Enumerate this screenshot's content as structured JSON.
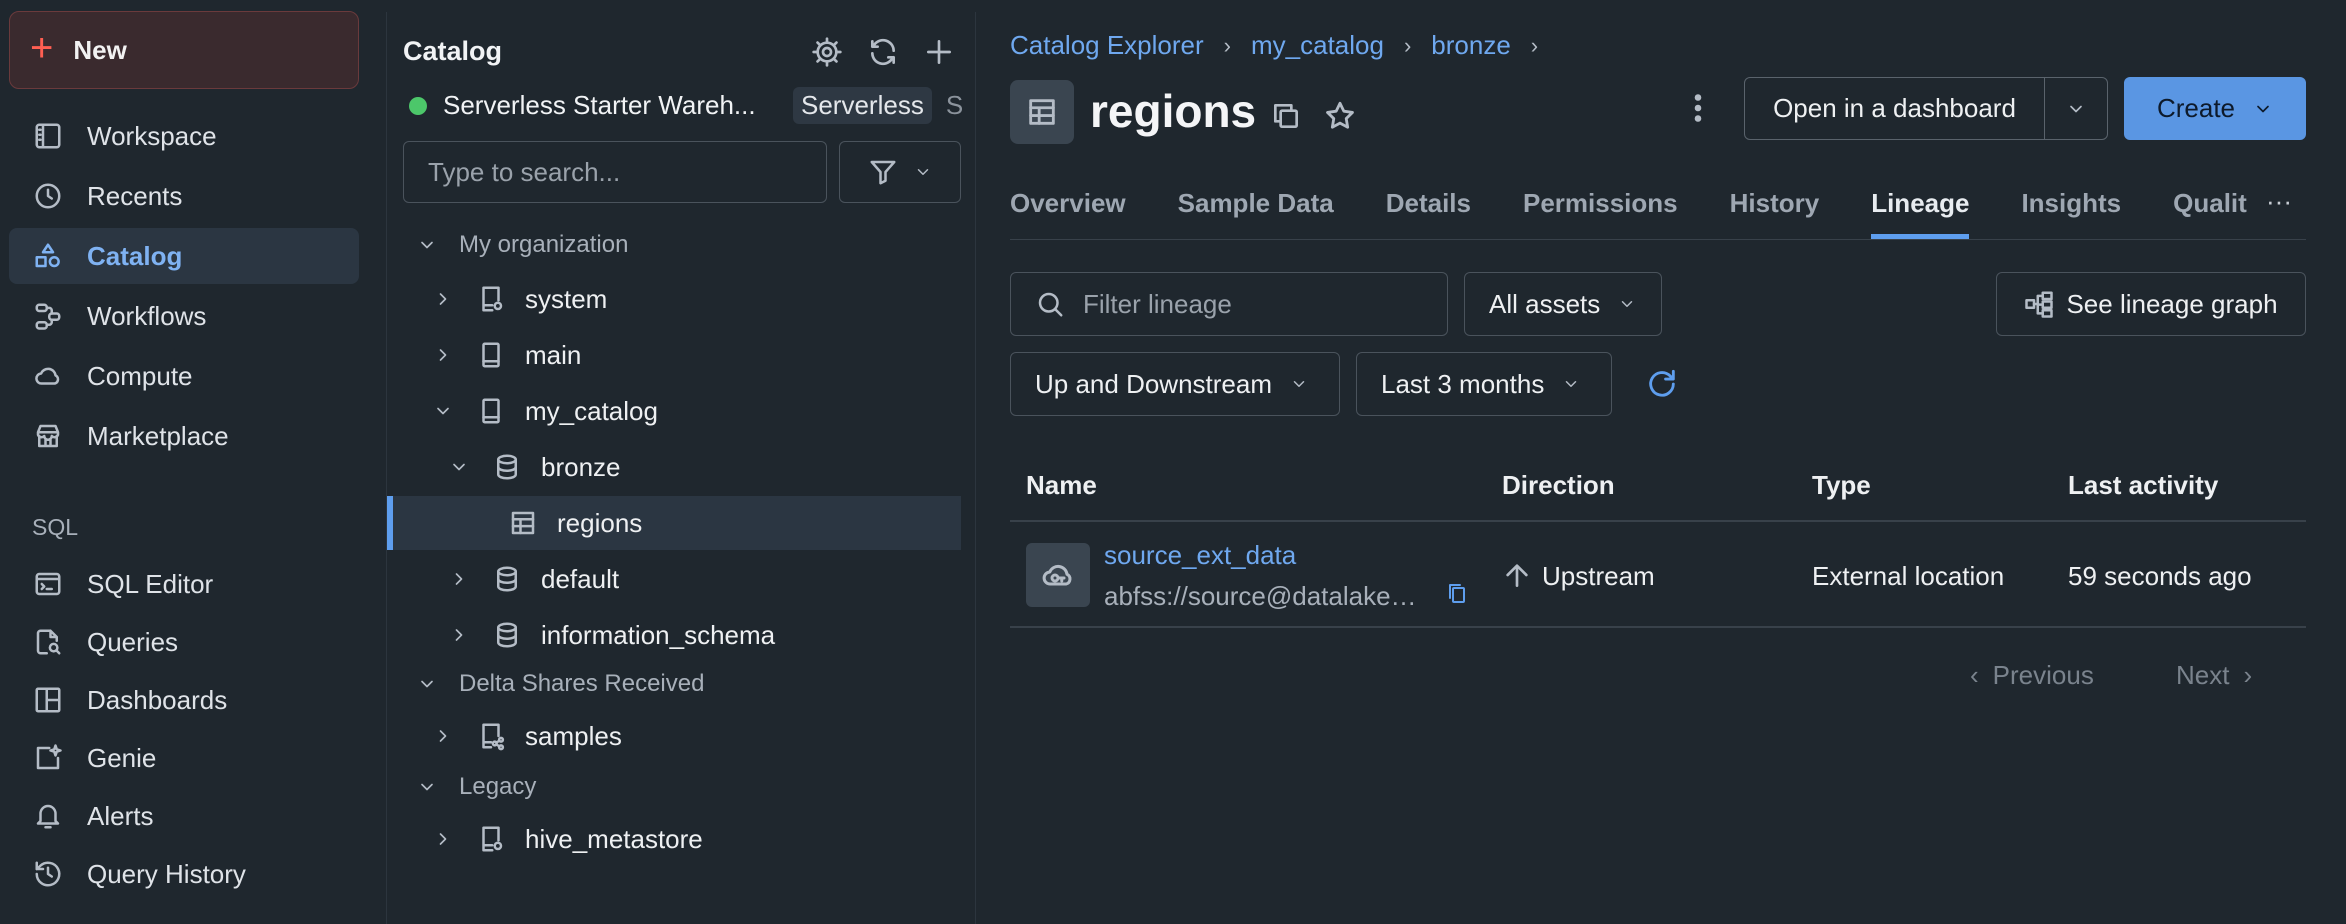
{
  "nav": {
    "new_label": "New",
    "items": [
      {
        "label": "Workspace",
        "icon": "workspace-icon"
      },
      {
        "label": "Recents",
        "icon": "clock-icon"
      },
      {
        "label": "Catalog",
        "icon": "catalog-icon",
        "active": true
      },
      {
        "label": "Workflows",
        "icon": "workflows-icon"
      },
      {
        "label": "Compute",
        "icon": "cloud-icon"
      },
      {
        "label": "Marketplace",
        "icon": "store-icon"
      }
    ],
    "sql_section": "SQL",
    "sql_items": [
      {
        "label": "SQL Editor",
        "icon": "sql-editor-icon"
      },
      {
        "label": "Queries",
        "icon": "queries-icon"
      },
      {
        "label": "Dashboards",
        "icon": "dashboards-icon"
      },
      {
        "label": "Genie",
        "icon": "genie-icon"
      },
      {
        "label": "Alerts",
        "icon": "bell-icon"
      },
      {
        "label": "Query History",
        "icon": "history-icon"
      }
    ]
  },
  "catalog": {
    "title": "Catalog",
    "warehouse_name": "Serverless Starter Wareh...",
    "warehouse_badge": "Serverless",
    "warehouse_more": "S",
    "search_placeholder": "Type to search...",
    "tree": {
      "sec_org": "My organization",
      "system": "system",
      "main": "main",
      "my_catalog": "my_catalog",
      "bronze": "bronze",
      "regions": "regions",
      "default": "default",
      "information_schema": "information_schema",
      "sec_delta": "Delta Shares Received",
      "samples": "samples",
      "sec_legacy": "Legacy",
      "hive_metastore": "hive_metastore"
    }
  },
  "main": {
    "breadcrumb": [
      "Catalog Explorer",
      "my_catalog",
      "bronze"
    ],
    "title": "regions",
    "open_dashboard": "Open in a dashboard",
    "create": "Create",
    "tabs": [
      "Overview",
      "Sample Data",
      "Details",
      "Permissions",
      "History",
      "Lineage",
      "Insights",
      "Qualit"
    ],
    "active_tab": "Lineage",
    "filter_placeholder": "Filter lineage",
    "assets_dropdown": "All assets",
    "see_graph": "See lineage graph",
    "direction_dropdown": "Up and Downstream",
    "time_dropdown": "Last 3 months",
    "table": {
      "headers": [
        "Name",
        "Direction",
        "Type",
        "Last activity"
      ],
      "rows": [
        {
          "name": "source_ext_data",
          "path": "abfss://source@datalakesu...",
          "direction": "Upstream",
          "type": "External location",
          "last_activity": "59 seconds ago"
        }
      ]
    },
    "pager": {
      "previous": "Previous",
      "next": "Next"
    }
  },
  "colors": {
    "accent": "#5e9eee",
    "link": "#6fa8ef",
    "new_plus": "#ff5f52",
    "status_green": "#4cc76a"
  }
}
